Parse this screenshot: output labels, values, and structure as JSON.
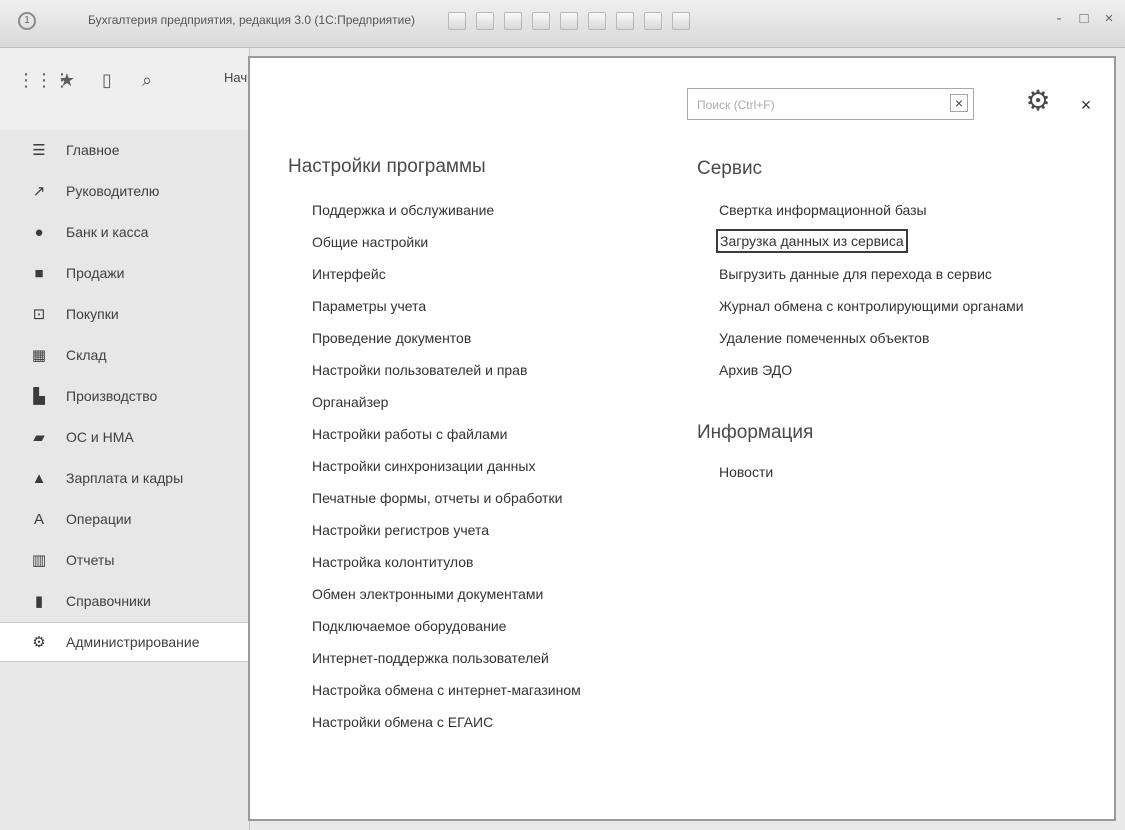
{
  "window": {
    "title": "Бухгалтерия предприятия, редакция 3.0  (1С:Предприятие)",
    "controls": [
      "-",
      "□",
      "×"
    ]
  },
  "quickbar": {
    "open_tab_text": "Нач"
  },
  "sidebar": {
    "items": [
      {
        "label": "Главное",
        "icon": "menu-icon"
      },
      {
        "label": "Руководителю",
        "icon": "trend-icon"
      },
      {
        "label": "Банк и касса",
        "icon": "bank-icon"
      },
      {
        "label": "Продажи",
        "icon": "sales-bag-icon"
      },
      {
        "label": "Покупки",
        "icon": "cart-icon"
      },
      {
        "label": "Склад",
        "icon": "warehouse-icon"
      },
      {
        "label": "Производство",
        "icon": "factory-icon"
      },
      {
        "label": "ОС и НМА",
        "icon": "truck-icon"
      },
      {
        "label": "Зарплата и кадры",
        "icon": "person-icon"
      },
      {
        "label": "Операции",
        "icon": "operations-icon"
      },
      {
        "label": "Отчеты",
        "icon": "bar-chart-icon"
      },
      {
        "label": "Справочники",
        "icon": "book-icon"
      },
      {
        "label": "Администрирование",
        "icon": "gear-icon"
      }
    ]
  },
  "search": {
    "placeholder": "Поиск (Ctrl+F)",
    "clear_label": "×"
  },
  "panel_controls": {
    "close_label": "×"
  },
  "sections": {
    "program_settings": {
      "title": "Настройки программы",
      "items": [
        "Поддержка и обслуживание",
        "Общие настройки",
        "Интерфейс",
        "Параметры учета",
        "Проведение документов",
        "Настройки пользователей и прав",
        "Органайзер",
        "Настройки работы с файлами",
        "Настройки синхронизации данных",
        "Печатные формы, отчеты и обработки",
        "Настройки регистров учета",
        "Настройка колонтитулов",
        "Обмен электронными документами",
        "Подключаемое оборудование",
        "Интернет-поддержка пользователей",
        "Настройка обмена с интернет-магазином",
        "Настройки обмена с ЕГАИС"
      ]
    },
    "service": {
      "title": "Сервис",
      "items": [
        "Свертка информационной базы",
        "Загрузка данных из сервиса",
        "Выгрузить данные для перехода в сервис",
        "Журнал обмена с контролирующими органами",
        "Удаление помеченных объектов",
        "Архив ЭДО"
      ]
    },
    "information": {
      "title": "Информация",
      "items": [
        "Новости"
      ]
    }
  }
}
